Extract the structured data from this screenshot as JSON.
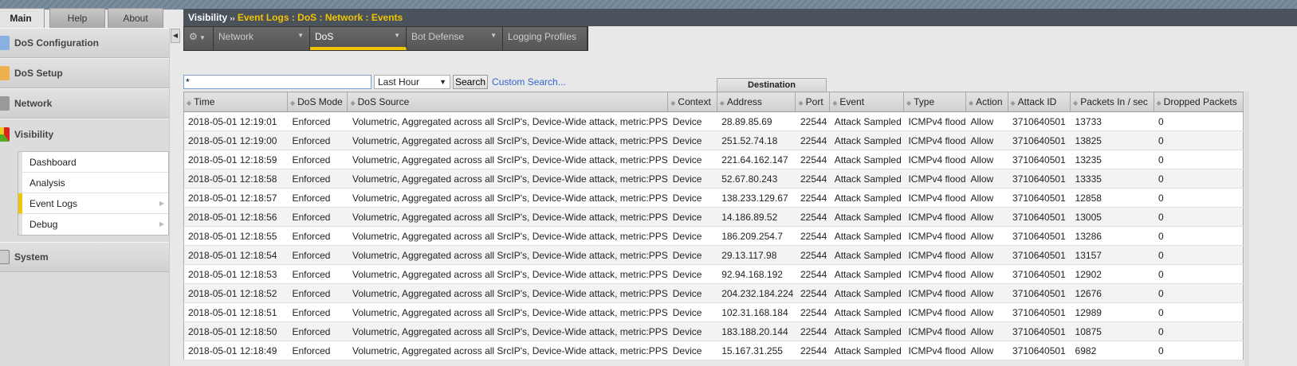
{
  "tabs": [
    "Main",
    "Help",
    "About"
  ],
  "sidebar": {
    "sections": [
      "DoS Configuration",
      "DoS Setup",
      "Network",
      "Visibility",
      "System"
    ],
    "visibility_items": [
      "Dashboard",
      "Analysis",
      "Event Logs",
      "Debug"
    ],
    "selected": "Event Logs"
  },
  "breadcrumb": {
    "root": "Visibility",
    "sep": "››",
    "path": "Event Logs : DoS : Network : Events"
  },
  "nav": {
    "items": [
      "Network",
      "DoS",
      "Bot Defense",
      "Logging Profiles"
    ],
    "active": "DoS"
  },
  "search": {
    "value": "*",
    "range": "Last Hour",
    "button": "Search",
    "custom": "Custom Search..."
  },
  "table": {
    "group_header": "Destination",
    "columns": [
      "Time",
      "DoS Mode",
      "DoS Source",
      "Context",
      "Address",
      "Port",
      "Event",
      "Type",
      "Action",
      "Attack ID",
      "Packets In / sec",
      "Dropped Packets"
    ],
    "rows": [
      [
        "2018-05-01 12:19:01",
        "Enforced",
        "Volumetric, Aggregated across all SrcIP's, Device-Wide attack, metric:PPS",
        "Device",
        "28.89.85.69",
        "22544",
        "Attack Sampled",
        "ICMPv4 flood",
        "Allow",
        "3710640501",
        "13733",
        "0"
      ],
      [
        "2018-05-01 12:19:00",
        "Enforced",
        "Volumetric, Aggregated across all SrcIP's, Device-Wide attack, metric:PPS",
        "Device",
        "251.52.74.18",
        "22544",
        "Attack Sampled",
        "ICMPv4 flood",
        "Allow",
        "3710640501",
        "13825",
        "0"
      ],
      [
        "2018-05-01 12:18:59",
        "Enforced",
        "Volumetric, Aggregated across all SrcIP's, Device-Wide attack, metric:PPS",
        "Device",
        "221.64.162.147",
        "22544",
        "Attack Sampled",
        "ICMPv4 flood",
        "Allow",
        "3710640501",
        "13235",
        "0"
      ],
      [
        "2018-05-01 12:18:58",
        "Enforced",
        "Volumetric, Aggregated across all SrcIP's, Device-Wide attack, metric:PPS",
        "Device",
        "52.67.80.243",
        "22544",
        "Attack Sampled",
        "ICMPv4 flood",
        "Allow",
        "3710640501",
        "13335",
        "0"
      ],
      [
        "2018-05-01 12:18:57",
        "Enforced",
        "Volumetric, Aggregated across all SrcIP's, Device-Wide attack, metric:PPS",
        "Device",
        "138.233.129.67",
        "22544",
        "Attack Sampled",
        "ICMPv4 flood",
        "Allow",
        "3710640501",
        "12858",
        "0"
      ],
      [
        "2018-05-01 12:18:56",
        "Enforced",
        "Volumetric, Aggregated across all SrcIP's, Device-Wide attack, metric:PPS",
        "Device",
        "14.186.89.52",
        "22544",
        "Attack Sampled",
        "ICMPv4 flood",
        "Allow",
        "3710640501",
        "13005",
        "0"
      ],
      [
        "2018-05-01 12:18:55",
        "Enforced",
        "Volumetric, Aggregated across all SrcIP's, Device-Wide attack, metric:PPS",
        "Device",
        "186.209.254.7",
        "22544",
        "Attack Sampled",
        "ICMPv4 flood",
        "Allow",
        "3710640501",
        "13286",
        "0"
      ],
      [
        "2018-05-01 12:18:54",
        "Enforced",
        "Volumetric, Aggregated across all SrcIP's, Device-Wide attack, metric:PPS",
        "Device",
        "29.13.117.98",
        "22544",
        "Attack Sampled",
        "ICMPv4 flood",
        "Allow",
        "3710640501",
        "13157",
        "0"
      ],
      [
        "2018-05-01 12:18:53",
        "Enforced",
        "Volumetric, Aggregated across all SrcIP's, Device-Wide attack, metric:PPS",
        "Device",
        "92.94.168.192",
        "22544",
        "Attack Sampled",
        "ICMPv4 flood",
        "Allow",
        "3710640501",
        "12902",
        "0"
      ],
      [
        "2018-05-01 12:18:52",
        "Enforced",
        "Volumetric, Aggregated across all SrcIP's, Device-Wide attack, metric:PPS",
        "Device",
        "204.232.184.224",
        "22544",
        "Attack Sampled",
        "ICMPv4 flood",
        "Allow",
        "3710640501",
        "12676",
        "0"
      ],
      [
        "2018-05-01 12:18:51",
        "Enforced",
        "Volumetric, Aggregated across all SrcIP's, Device-Wide attack, metric:PPS",
        "Device",
        "102.31.168.184",
        "22544",
        "Attack Sampled",
        "ICMPv4 flood",
        "Allow",
        "3710640501",
        "12989",
        "0"
      ],
      [
        "2018-05-01 12:18:50",
        "Enforced",
        "Volumetric, Aggregated across all SrcIP's, Device-Wide attack, metric:PPS",
        "Device",
        "183.188.20.144",
        "22544",
        "Attack Sampled",
        "ICMPv4 flood",
        "Allow",
        "3710640501",
        "10875",
        "0"
      ],
      [
        "2018-05-01 12:18:49",
        "Enforced",
        "Volumetric, Aggregated across all SrcIP's, Device-Wide attack, metric:PPS",
        "Device",
        "15.167.31.255",
        "22544",
        "Attack Sampled",
        "ICMPv4 flood",
        "Allow",
        "3710640501",
        "6982",
        "0"
      ]
    ]
  },
  "colors": {
    "accent": "#f2c300",
    "header_bar": "#4a535c",
    "link": "#3366cc"
  }
}
